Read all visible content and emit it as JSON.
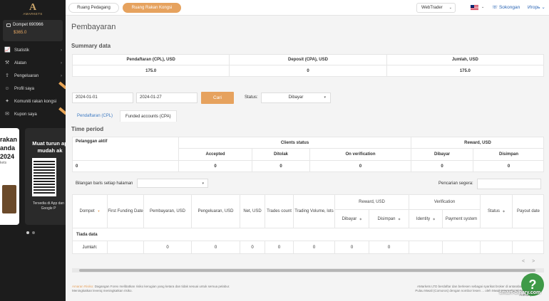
{
  "brand": {
    "logo_mark": "A",
    "logo_text": "AMARKETS"
  },
  "sidebar": {
    "wallet_label": "Dompet 690966",
    "wallet_amount": "$365.0",
    "items": [
      {
        "label": "Statistik",
        "icon": "chart-icon",
        "chevron": "›"
      },
      {
        "label": "Alatan",
        "icon": "tools-icon",
        "chevron": "›"
      },
      {
        "label": "Pengeluaran",
        "icon": "withdraw-icon",
        "chevron": "›"
      },
      {
        "label": "Profil saya",
        "icon": "user-icon",
        "chevron": ""
      },
      {
        "label": "Komuniti rakan kongsi",
        "icon": "community-icon",
        "chevron": ""
      },
      {
        "label": "Kupon saya",
        "icon": "coupon-icon",
        "chevron": ""
      }
    ],
    "promo_left_lines": [
      "rakan",
      "anda",
      "2024",
      "kets"
    ],
    "promo_right_title": "Muat turun ap mudah ak",
    "promo_right_footer": "Tersedia di App dan Google P"
  },
  "topbar": {
    "tab1": "Ruang Pedagang",
    "tab2": "Ruang Rakan Kongsi",
    "webtrader": "WebTrader",
    "sokongan": "Sokongan",
    "user": "Игорь"
  },
  "page": {
    "title": "Pembayaran"
  },
  "summary": {
    "title": "Summary data",
    "headers": [
      "Pendaftaran (CPL), USD",
      "Deposit (CPA), USD",
      "Jumlah, USD"
    ],
    "values": [
      "175.0",
      "0",
      "175.0"
    ]
  },
  "filters": {
    "date_from": "2024-01-01",
    "date_to": "2024-01-27",
    "search_button": "Cari",
    "status_label": "Status:",
    "status_value": "Dibayar"
  },
  "subtabs": {
    "cpl": "Pendaftaran (CPL)",
    "cpa": "Funded accounts (CPA)"
  },
  "time_period": {
    "title": "Time period",
    "pelanggan": "Pelanggan aktif",
    "clients_status": "Clients status",
    "reward": "Reward, USD",
    "sub": [
      "Accepted",
      "Ditolak",
      "On verification",
      "Dibayar",
      "Disimpan"
    ],
    "values": [
      "0",
      "0",
      "0",
      "0",
      "0",
      "0"
    ]
  },
  "table_controls": {
    "rows_label": "Bilangan baris setiap halaman",
    "search_label": "Pencarian segera:"
  },
  "table": {
    "headers": [
      "Dompet",
      "First Funding Date",
      "Pembayaran, USD",
      "Pengeluaran, USD",
      "Net, USD",
      "Trades count",
      "Trading Volume, lots",
      "Reward, USD",
      "Verification",
      "Status",
      "Payout date"
    ],
    "reward_sub": [
      "Dibayar",
      "Disimpan"
    ],
    "verification_sub": [
      "Identity",
      "Payment system"
    ],
    "empty": "Tiada data",
    "total_label": "Jumlah:",
    "totals": [
      "0",
      "0",
      "0",
      "0",
      "0",
      "0",
      "0"
    ]
  },
  "pager": {
    "prev": "<",
    "next": ">"
  },
  "footer": {
    "warning_label": "Amaran Risiko:",
    "warning_text": "Dagangan Forex melibatkan risiko kerugian yang ketara dan tidak sesuai untuk semua pelabur. Meningkatkan leveraj meningkatkan risiko.",
    "right_text": "AMarkets LTD berdaftar dan berlesen sebagai syarikat broker di antarabangsa di Pulau Mwali (Comoros) dengan nombor lesen ... oleh Mwali International Services Authority"
  },
  "help": {
    "icon": "question-icon",
    "label": "?"
  },
  "watermark": "smart-binary.com"
}
